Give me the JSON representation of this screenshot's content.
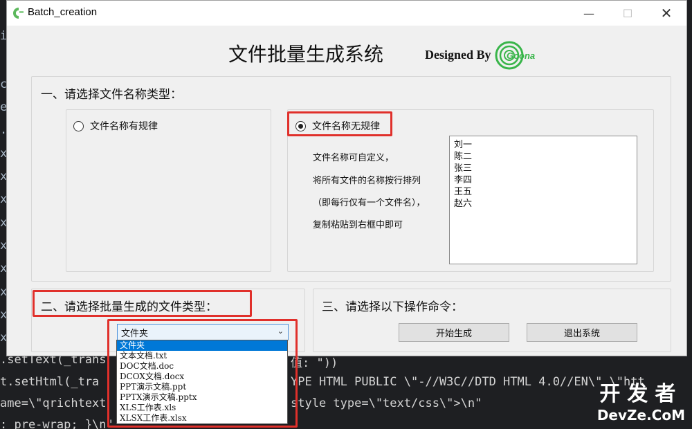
{
  "window": {
    "title": "Batch_creation",
    "minimize_glyph": "—",
    "maximize_glyph": "☐",
    "close_glyph": "✕"
  },
  "header": {
    "title": "文件批量生成系统",
    "designed_by": "Designed By",
    "logo_text": "Goona"
  },
  "section1": {
    "label": "一、请选择文件名称类型：",
    "radio_regular": "文件名称有规律",
    "radio_irregular": "文件名称无规律",
    "selected": "irregular",
    "desc": [
      "文件名称可自定义，",
      "将所有文件的名称按行排列",
      "（即每行仅有一个文件名），",
      "复制粘贴到右框中即可"
    ],
    "names": [
      "刘一",
      "陈二",
      "张三",
      "李四",
      "王五",
      "赵六"
    ]
  },
  "section2": {
    "label": "二、请选择批量生成的文件类型：",
    "combo_value": "文件夹",
    "options": [
      "文件夹",
      "文本文档.txt",
      "DOC文档.doc",
      "DCOX文档.docx",
      "PPT演示文稿.ppt",
      "PPTX演示文稿.pptx",
      "XLS工作表.xls",
      "XLSX工作表.xlsx"
    ]
  },
  "section3": {
    "label": "三、请选择以下操作命令：",
    "start_button": "开始生成",
    "exit_button": "退出系统"
  },
  "background_code": {
    "gutter": [
      "i",
      "c",
      "e",
      ".",
      "x",
      "x",
      "x",
      "x",
      "x",
      "x",
      "x",
      "x",
      "x",
      ".",
      "."
    ],
    "lines": [
      ".setText(_trans",
      "值: \"))",
      "t.setHtml(_tra",
      "YPE HTML PUBLIC \\\"-//W3C//DTD HTML 4.0//EN\\\" \\\"htt",
      "ame=\\\"qrichtext",
      "style type=\\\"text/css\\\">\\n\"",
      ": pre-wrap; }\\n\""
    ]
  },
  "watermark": {
    "cn": "开发者",
    "en": "DevZe.CoM"
  },
  "colors": {
    "highlight": "#e0302b",
    "selection": "#0078d7",
    "logo_green": "#39b54a"
  }
}
